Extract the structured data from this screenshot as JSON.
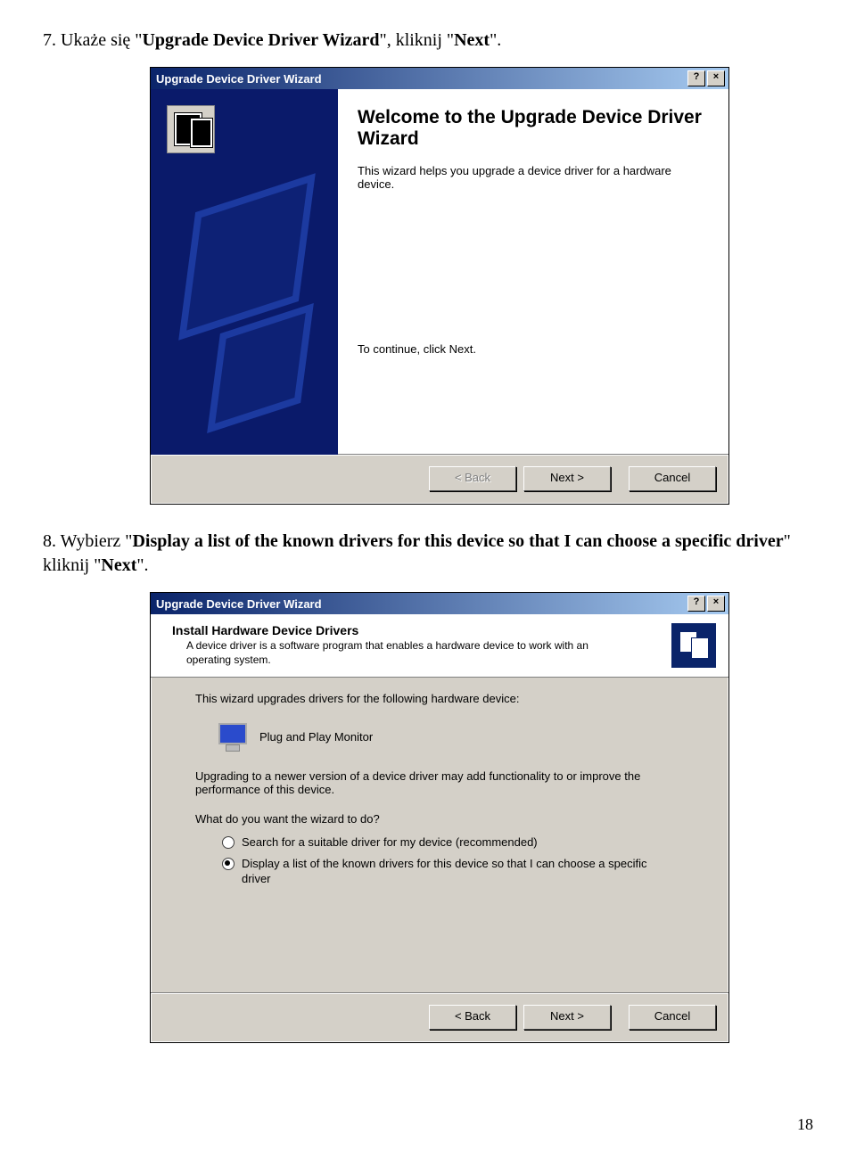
{
  "instr7": {
    "prefix": "7. Ukaże się \"",
    "bold": "Upgrade Device Driver Wizard",
    "mid": "\", kliknij \"",
    "bold2": "Next",
    "suffix": "\"."
  },
  "instr8": {
    "prefix": "8. Wybierz \"",
    "bold": "Display a list of the known drivers for this device so that I can choose a specific driver",
    "mid": "\" kliknij \"",
    "bold2": "Next",
    "suffix": "\"."
  },
  "dialog1": {
    "title": "Upgrade Device Driver Wizard",
    "heading": "Welcome to the Upgrade Device Driver Wizard",
    "desc": "This wizard helps you upgrade a device driver for a hardware device.",
    "continue": "To continue, click Next.",
    "back": "< Back",
    "next": "Next >",
    "cancel": "Cancel"
  },
  "dialog2": {
    "title": "Upgrade Device Driver Wizard",
    "headerTitle": "Install Hardware Device Drivers",
    "headerSub": "A device driver is a software program that enables a hardware device to work with an operating system.",
    "line1": "This wizard upgrades drivers for the following hardware device:",
    "device": "Plug and Play Monitor",
    "line2": "Upgrading to a newer version of a device driver may add functionality to or improve the performance of this device.",
    "question": "What do you want the wizard to do?",
    "opt1": "Search for a suitable driver for my device (recommended)",
    "opt2": "Display a list of the known drivers for this device so that I can choose a specific driver",
    "back": "< Back",
    "next": "Next >",
    "cancel": "Cancel"
  },
  "pageNumber": "18"
}
